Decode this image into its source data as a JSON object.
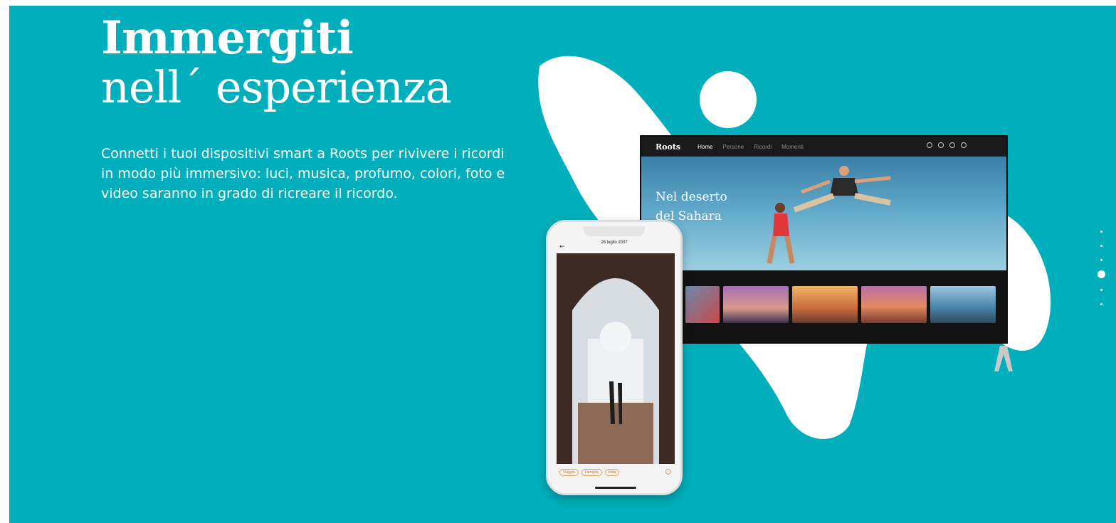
{
  "colors": {
    "background": "#00afbb",
    "text": "#ffffff",
    "tag": "#e0a15c"
  },
  "hero": {
    "title_line1": "Immergiti",
    "title_line2": "nell´ esperienza",
    "description": "Connetti i tuoi dispositivi smart a Roots per rivivere i ricordi in modo più immersivo: luci, musica, profumo, colori, foto e video saranno in grado di ricreare il ricordo."
  },
  "tv": {
    "logo": "Roots",
    "nav": [
      "Home",
      "Persone",
      "Ricordi",
      "Momenti"
    ],
    "active_nav": "Home",
    "icons": [
      "search-icon",
      "globe-icon",
      "timer-icon",
      "profile-icon"
    ],
    "hero_title_line1": "Nel deserto",
    "hero_title_line2": "del Sahara"
  },
  "phone": {
    "date": "26 luglio 2007",
    "back_icon": "arrow-left-icon",
    "tags": [
      "Viaggio",
      "Famiglia",
      "India"
    ],
    "share_icon": "share-icon"
  },
  "pagination": {
    "total": 6,
    "active_index": 3
  }
}
